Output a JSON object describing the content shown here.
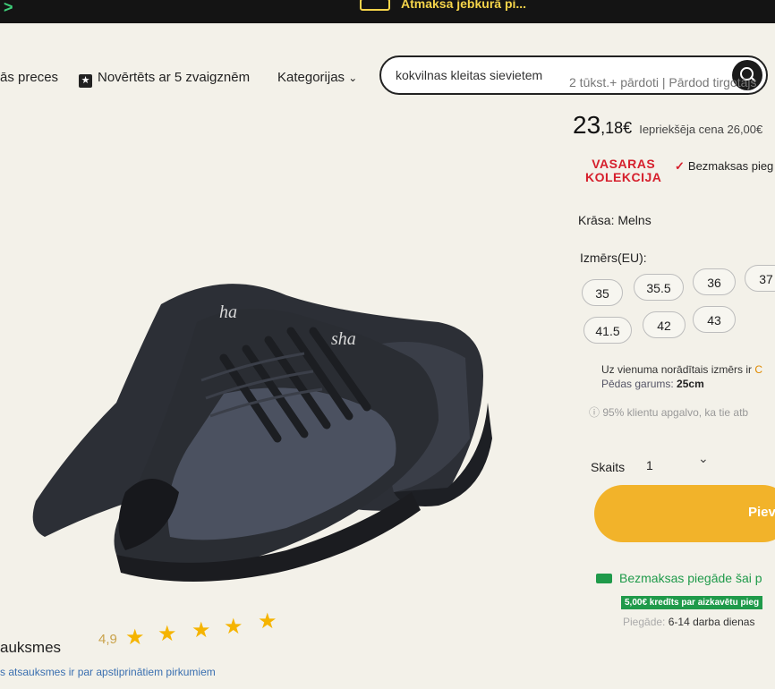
{
  "topbar": {
    "chevron": ">",
    "promo_text": "Atmaksa jebkurā pi..."
  },
  "nav": {
    "item1": "ās preces",
    "item2": "Novērtēts ar 5 zvaigznēm",
    "categories": "Kategorijas",
    "categories_chevron": "⌄"
  },
  "search": {
    "value": "kokvilnas kleitas sievietem"
  },
  "product": {
    "sold_info": "2 tūkst.+ pārdoti | Pārdod tirgotājs",
    "price_int": "23",
    "price_dec": ",18€",
    "old_price": "Iepriekšēja cena 26,00€",
    "badge_line1": "VASARAS",
    "badge_line2": "KOLEKCIJA",
    "free_shipping": "Bezmaksas pieg",
    "color_label": "Krāsa: Melns",
    "size_label": "Izmērs(EU):",
    "sizes": [
      "35",
      "35.5",
      "36",
      "37",
      "41.5",
      "42",
      "43"
    ],
    "size_note": "Uz vienuma norādītais izmērs ir ",
    "size_note_link": "C",
    "foot_length": "Pēdas garums: ",
    "foot_length_value": "25cm",
    "trust_note": "ⓘ 95% klientu apgalvo, ka tie atb",
    "quantity_label": "Skaits",
    "quantity_value": "1",
    "add_button": "Piev",
    "shipping_line": "Bezmaksas piegāde šai p",
    "credit_badge": "5,00€ kredīts par aizkavētu pieg",
    "delivery_label": "Piegāde: ",
    "delivery_value": "6-14 darba dienas"
  },
  "reviews": {
    "title": "auksmes",
    "rating": "4,9",
    "stars": 5,
    "subtitle": "s atsauksmes ir par apstiprinātiem pirkumiem"
  },
  "colors": {
    "accent": "#f2b32a",
    "badge": "#d61f2c",
    "green": "#1f9a4a"
  },
  "icons": [
    "search-icon",
    "star-icon",
    "check-icon",
    "truck-icon",
    "info-icon",
    "chevron-down-icon"
  ]
}
